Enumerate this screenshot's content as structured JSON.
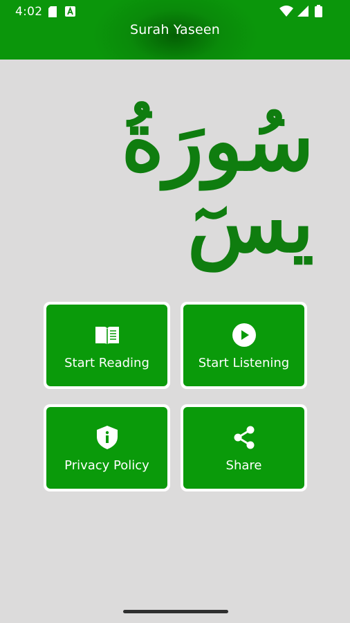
{
  "status_bar": {
    "time": "4:02",
    "left_icons": [
      "sd-card-icon",
      "text-a-icon"
    ],
    "right_icons": [
      "wifi-icon",
      "signal-icon",
      "battery-icon"
    ]
  },
  "app_bar": {
    "title": "Surah Yaseen",
    "color": "#0a8a0a"
  },
  "hero": {
    "calligraphy_text": "سُورَةُ يسٓ",
    "color": "#0f7d0f"
  },
  "menu": {
    "tiles": [
      {
        "label": "Start Reading",
        "icon": "open-book-icon"
      },
      {
        "label": "Start Listening",
        "icon": "play-circle-icon"
      },
      {
        "label": "Privacy Policy",
        "icon": "shield-info-icon"
      },
      {
        "label": "Share",
        "icon": "share-icon"
      }
    ],
    "tile_color": "#0a9a0a"
  },
  "nav": {
    "gesture_bar": "home-gesture-handle"
  }
}
